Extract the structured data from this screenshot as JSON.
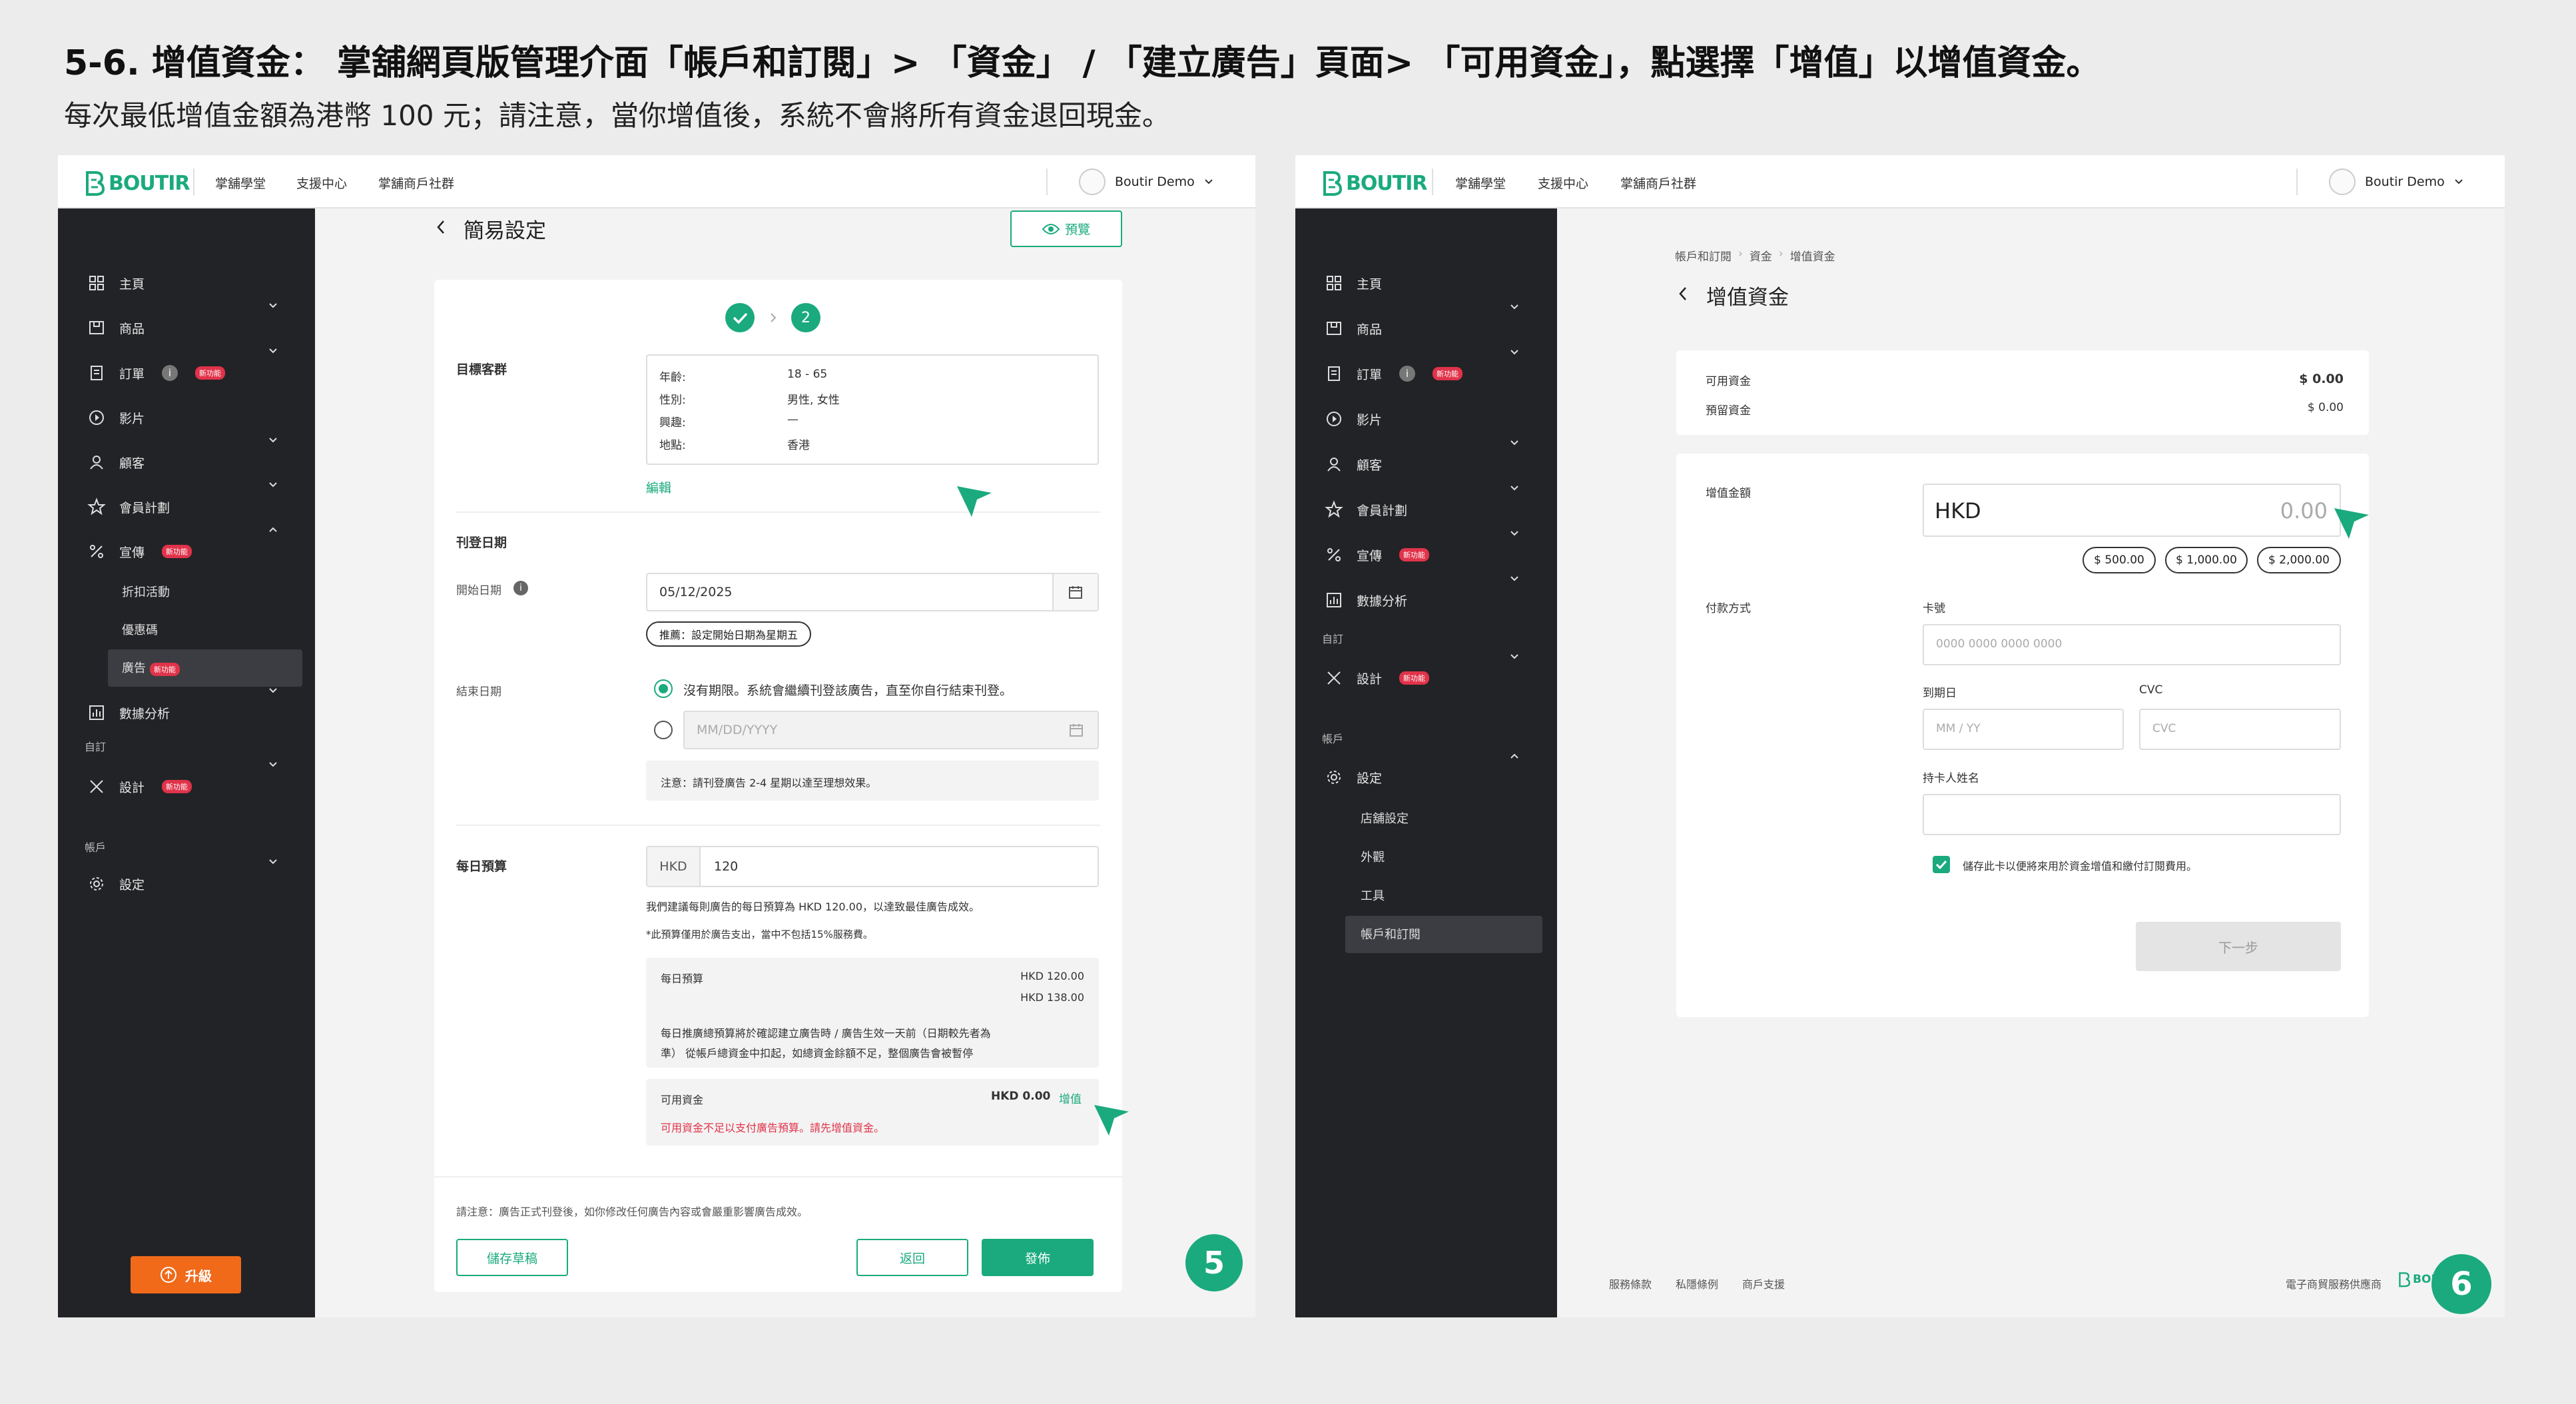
{
  "header": {
    "title": "5-6. 增值資金： 掌舖網頁版管理介面「帳戶和訂閱」> 「資金」 / 「建立廣告」頁面> 「可用資金」，點選擇「增值」以增值資金。",
    "subtitle": "每次最低增值金額為港幣 100 元；請注意，當你增值後，系統不會將所有資金退回現金。"
  },
  "topbar": {
    "logo": "BOUTIR",
    "nav": [
      "掌舖學堂",
      "支援中心",
      "掌舖商戶社群"
    ],
    "user": "Boutir Demo"
  },
  "sidebar5": {
    "items": [
      "主頁",
      "商品",
      "訂單",
      "影片",
      "顧客",
      "會員計劃",
      "宣傳",
      "數據分析",
      "設計",
      "設定"
    ],
    "promo_sub": [
      "折扣活動",
      "優惠碼",
      "廣告"
    ],
    "section_custom": "自訂",
    "section_account": "帳戶",
    "badge": "新功能",
    "info": "i",
    "upgrade": "升級"
  },
  "sidebar6": {
    "items": [
      "主頁",
      "商品",
      "訂單",
      "影片",
      "顧客",
      "會員計劃",
      "宣傳",
      "數據分析",
      "設計",
      "設定"
    ],
    "settings_sub": [
      "店舖設定",
      "外觀",
      "工具",
      "帳戶和訂閱"
    ],
    "section_custom": "自訂",
    "section_account": "帳戶",
    "badge": "新功能",
    "info": "i",
    "upgrade": "升級"
  },
  "ad": {
    "back_title": "簡易設定",
    "preview": "預覽",
    "step2": "2",
    "audience_label": "目標客群",
    "audience": [
      {
        "k": "年齡:",
        "v": "18 - 65"
      },
      {
        "k": "性別:",
        "v": "男性, 女性"
      },
      {
        "k": "興趣:",
        "v": "—"
      },
      {
        "k": "地點:",
        "v": "香港"
      }
    ],
    "edit": "編輯",
    "schedule_label": "刊登日期",
    "start_label": "開始日期",
    "start_value": "05/12/2025",
    "recommend": "推薦：設定開始日期為星期五",
    "end_label": "結束日期",
    "no_end": "沒有期限。系統會繼續刊登該廣告，直至你自行結束刊登。",
    "end_placeholder": "MM/DD/YYYY",
    "note": "注意：請刊登廣告 2-4 星期以達至理想效果。",
    "budget_label": "每日預算",
    "currency": "HKD",
    "budget_value": "120",
    "budget_hint": "我們建議每則廣告的每日預算為 HKD 120.00，以達致最佳廣告成效。",
    "budget_hint2": "*此預算僅用於廣告支出，當中不包括15%服務費。",
    "daily_budget_label": "每日預算",
    "daily_budget_v1": "HKD 120.00",
    "daily_budget_v2": "HKD 138.00",
    "daily_desc1": "每日推廣總預算將於確認建立廣告時 / 廣告生效一天前（日期較先者為",
    "daily_desc2": "準） 從帳戶總資金中扣起，如總資金餘額不足，整個廣告會被暫停",
    "funds_label": "可用資金",
    "funds_value": "HKD 0.00",
    "topup": "增值",
    "funds_warn": "可用資金不足以支付廣告預算。請先增值資金。",
    "footer_note": "請注意：廣告正式刊登後，如你修改任何廣告內容或會嚴重影響廣告成效。",
    "save_draft": "儲存草稿",
    "back": "返回",
    "publish": "發佈",
    "step_number": "5"
  },
  "topup": {
    "breadcrumb": [
      "帳戶和訂閱",
      "資金",
      "增值資金"
    ],
    "title": "增值資金",
    "available_label": "可用資金",
    "available_value": "$ 0.00",
    "reserved_label": "預留資金",
    "reserved_value": "$ 0.00",
    "amount_label": "增值金額",
    "currency": "HKD",
    "amount_placeholder": "0.00",
    "presets": [
      "$ 500.00",
      "$ 1,000.00",
      "$ 2,000.00"
    ],
    "payment_label": "付款方式",
    "card_label": "卡號",
    "card_placeholder": "0000 0000 0000 0000",
    "expiry_label": "到期日",
    "expiry_placeholder": "MM / YY",
    "cvc_label": "CVC",
    "cvc_placeholder": "CVC",
    "holder_label": "持卡人姓名",
    "save_card": "儲存此卡以便將來用於資金增值和繳付訂閱費用。",
    "next": "下一步",
    "footer_links": [
      "服務條款",
      "私隱條例",
      "商戶支援"
    ],
    "footer_right": "電子商貿服務供應商",
    "step_number": "6"
  }
}
